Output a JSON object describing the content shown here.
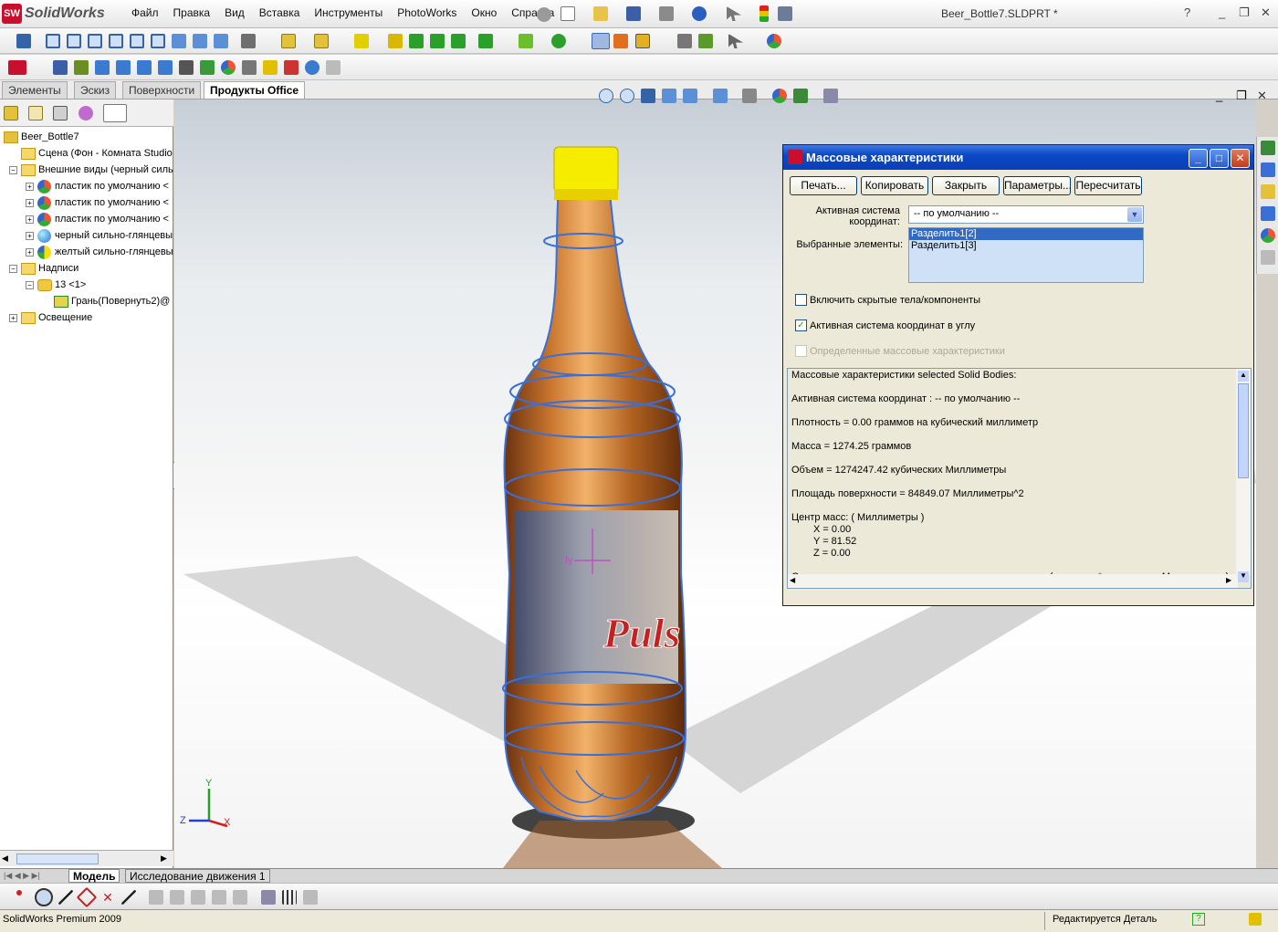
{
  "app": {
    "logo_text": "SolidWorks",
    "window_title": "Beer_Bottle7.SLDPRT *",
    "menu": [
      "Файл",
      "Правка",
      "Вид",
      "Вставка",
      "Инструменты",
      "PhotoWorks",
      "Окно",
      "Справка"
    ]
  },
  "command_tabs": [
    "Элементы",
    "Эскиз",
    "Поверхности",
    "Продукты Office"
  ],
  "tree": {
    "root": "Beer_Bottle7",
    "items": [
      {
        "label": "Сцена (Фон - Комната Studio",
        "icon": "folder-icon",
        "expander": ""
      },
      {
        "label": "Внешние виды (черный силь",
        "icon": "folder-icon",
        "expander": "−"
      },
      {
        "label": "пластик по умолчанию <",
        "icon": "appearance-ball-icon",
        "expander": "+"
      },
      {
        "label": "пластик по умолчанию <",
        "icon": "appearance-ball-icon",
        "expander": "+"
      },
      {
        "label": "пластик по умолчанию <",
        "icon": "appearance-ball-icon",
        "expander": "+"
      },
      {
        "label": "черный сильно-глянцевы",
        "icon": "appearance-ball-icon",
        "expander": "+"
      },
      {
        "label": "желтый сильно-глянцевы",
        "icon": "appearance-ball-icon",
        "expander": "+"
      },
      {
        "label": "Надписи",
        "icon": "folder-icon",
        "expander": "−"
      },
      {
        "label": "13 <1>",
        "icon": "decal-icon",
        "expander": "−"
      },
      {
        "label": "Грань(Повернуть2)@",
        "icon": "face-icon",
        "expander": ""
      },
      {
        "label": "Освещение",
        "icon": "lighting-icon",
        "expander": "+"
      }
    ]
  },
  "bottom_tabs": [
    "Модель",
    "Исследование движения 1"
  ],
  "status": {
    "left": "SolidWorks Premium 2009",
    "right": "Редактируется Деталь"
  },
  "axis": {
    "x": "X",
    "y": "Y",
    "z": "Z"
  },
  "dialog": {
    "title": "Массовые характеристики",
    "buttons": [
      "Печать...",
      "Копировать",
      "Закрыть",
      "Параметры...",
      "Пересчитать"
    ],
    "coord_label": "Активная система координат:",
    "coord_value": "-- по умолчанию --",
    "selected_label": "Выбранные элементы:",
    "selected": [
      "Разделить1[2]",
      "Разделить1[3]"
    ],
    "checkboxes": [
      {
        "label": "Включить скрытые тела/компоненты",
        "checked": false,
        "disabled": false
      },
      {
        "label": "Активная система координат в углу",
        "checked": true,
        "disabled": false
      },
      {
        "label": "Определенные массовые характеристики",
        "checked": false,
        "disabled": true
      }
    ],
    "results": [
      "Массовые характеристики selected Solid Bodies:",
      "Активная система координат : -- по умолчанию --",
      "Плотность = 0.00 граммов на кубический миллиметр",
      "Масса = 1274.25 граммов",
      "Объем = 1274247.42 кубических Миллиметры",
      "Площадь поверхности = 84849.07 Миллиметры^2",
      "Центр масс: ( Миллиметры )",
      "X = 0.00",
      "Y = 81.52",
      "Z = 0.00",
      "Основные оси инерции и основные моменты инерции: ( граммов * квадратных Миллиметры )"
    ]
  },
  "triad_labels": {
    "iy": "Iy"
  }
}
